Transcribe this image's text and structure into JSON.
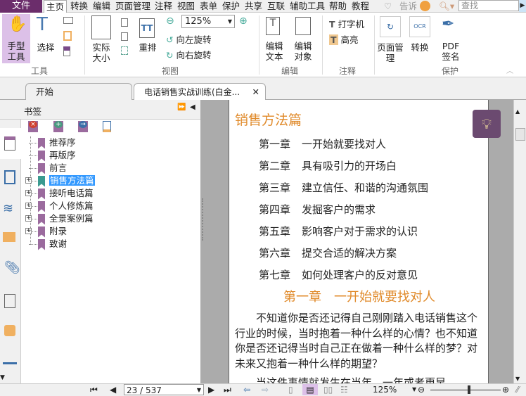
{
  "menu": {
    "file": "文件",
    "items": [
      "主页",
      "转换",
      "编辑",
      "页面管理",
      "注释",
      "视图",
      "表单",
      "保护",
      "共享",
      "互联",
      "辅助工具",
      "帮助",
      "教程"
    ],
    "tell": "告诉",
    "search_placeholder": "查找"
  },
  "ribbon": {
    "hand": "手型工具",
    "select": "选择",
    "actual_size": "实际大小",
    "reflow": "重排",
    "zoom_value": "125%",
    "rotate_left": "向左旋转",
    "rotate_right": "向右旋转",
    "edit_text": "编辑文本",
    "edit_object": "编辑对象",
    "typewriter": "打字机",
    "highlight": "高亮",
    "page_manage": "页面管理",
    "convert": "转换",
    "pdf_sign": "PDF签名",
    "groups": {
      "tools": "工具",
      "view": "视图",
      "edit": "编辑",
      "comment": "注释",
      "protect": "保护"
    }
  },
  "tabs": [
    {
      "label": "开始"
    },
    {
      "label": "电话销售实战训练(白金..."
    }
  ],
  "bookmarks": {
    "title": "书签",
    "items": [
      {
        "label": "推荐序",
        "expandable": false
      },
      {
        "label": "再版序",
        "expandable": false
      },
      {
        "label": "前言",
        "expandable": false
      },
      {
        "label": "销售方法篇",
        "expandable": true,
        "selected": true
      },
      {
        "label": "接听电话篇",
        "expandable": true
      },
      {
        "label": "个人修炼篇",
        "expandable": true
      },
      {
        "label": "全景案例篇",
        "expandable": true
      },
      {
        "label": "附录",
        "expandable": true
      },
      {
        "label": "致谢",
        "expandable": false
      }
    ]
  },
  "document": {
    "section_title": "销售方法篇",
    "toc": [
      {
        "ch": "第一章",
        "title": "一开始就要找对人"
      },
      {
        "ch": "第二章",
        "title": "具有吸引力的开场白"
      },
      {
        "ch": "第三章",
        "title": "建立信任、和谐的沟通氛围"
      },
      {
        "ch": "第四章",
        "title": "发掘客户的需求"
      },
      {
        "ch": "第五章",
        "title": "影响客户对于需求的认识"
      },
      {
        "ch": "第六章",
        "title": "提交合适的解决方案"
      },
      {
        "ch": "第七章",
        "title": "如何处理客户的反对意见"
      }
    ],
    "chapter_heading": "第一章　一开始就要找对人",
    "paragraph": "　　不知道你是否还记得自己刚刚踏入电话销售这个行业的时候，当时抱着一种什么样的心情？也不知道你是否还记得当时自己正在做着一种什么样的梦？对未来又抱着一种什么样的期望？",
    "paragraph2": "　　当这件事情就发生在当年，一年或者更早"
  },
  "status": {
    "page": "23 / 537",
    "zoom": "125%",
    "zoom_slider": 0.55
  },
  "colors": {
    "accent": "#6b2d6b",
    "heading": "#e08a2a",
    "selection": "#3399ff"
  }
}
